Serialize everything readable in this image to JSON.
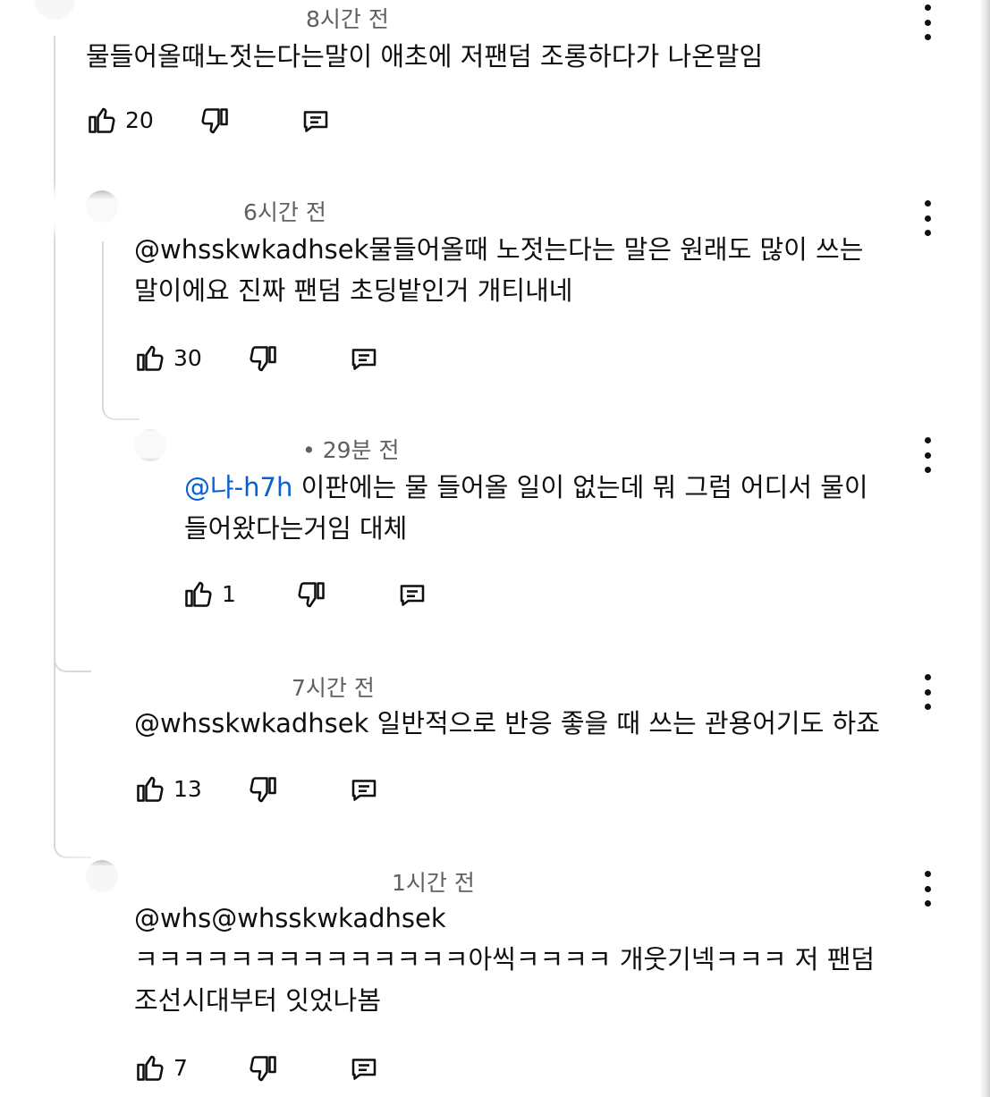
{
  "comments": [
    {
      "time": "8시간 전",
      "text_lines": [
        "물들어올때노젓는다는말이 애초에 저팬덤 조롱하다가 나온말임"
      ],
      "likes": "20",
      "icons": [
        "thumbs-up-icon",
        "thumbs-down-icon",
        "reply-icon",
        "more-vert-icon"
      ]
    },
    {
      "time": "6시간 전",
      "mention": "@whsskwkadhsek",
      "text_lines": [
        "물들어올때 노젓는다는 말은 원래도 많이 쓰는",
        "말이에요 진짜 팬덤 초딩밭인거 개티내네"
      ],
      "likes": "30"
    },
    {
      "time": "• 29분 전",
      "mention": "@냐-h7h",
      "text_lines": [
        " 이판에는 물 들어올 일이 없는데 뭐 그럼 어디서 물이",
        "들어왔다는거임 대체"
      ],
      "likes": "1"
    },
    {
      "time": "7시간 전",
      "mention": "@whsskwkadhsek",
      "text_lines": [
        " 일반적으로 반응 좋을 때 쓰는 관용어기도 하죠"
      ],
      "likes": "13"
    },
    {
      "time": "1시간 전",
      "text_lines": [
        "@whs@whsskwkadhsek",
        "ㅋㅋㅋㅋㅋㅋㅋㅋㅋㅋㅋㅋㅋㅋ아씩ㅋㅋㅋㅋ 개웃기넥ㅋㅋㅋ 저 팬덤",
        "조선시대부터 잇었나봄"
      ],
      "likes": "7"
    }
  ],
  "colors": {
    "text": "#0f0f0f",
    "meta": "#606060",
    "mention": "#065fd4",
    "thread_line": "#d8d8d8"
  }
}
